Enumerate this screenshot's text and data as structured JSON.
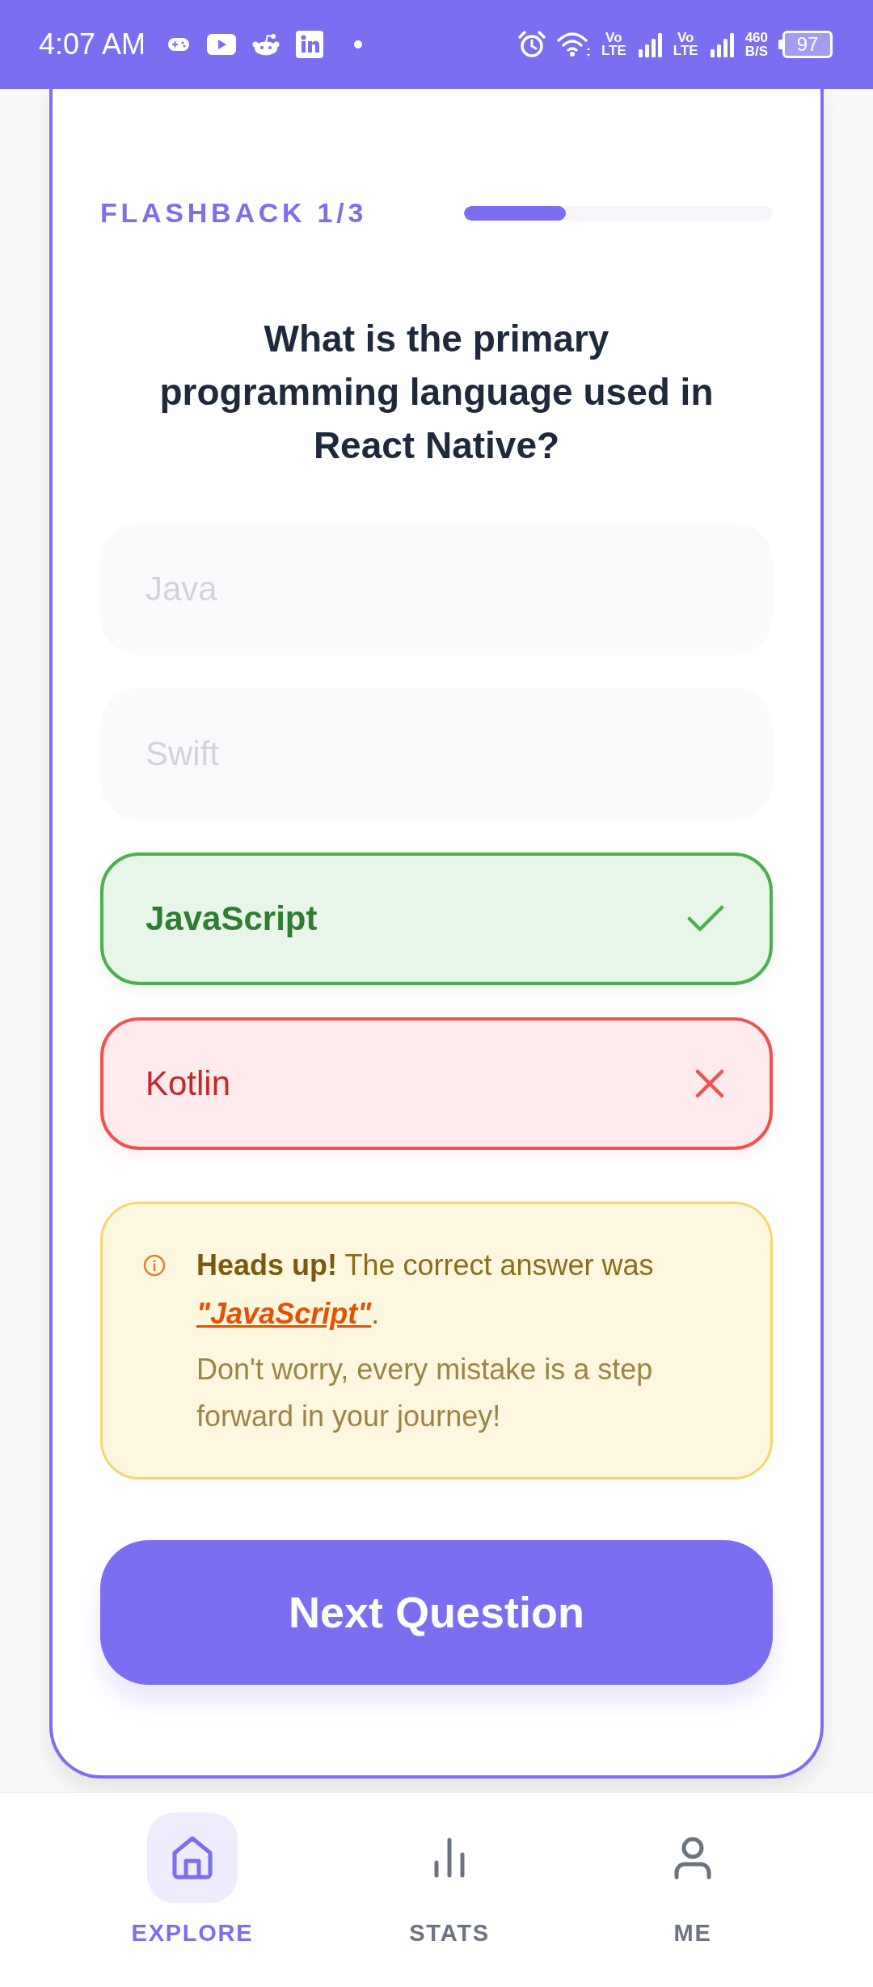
{
  "status_bar": {
    "time": "4:07 AM",
    "network": [
      {
        "line1": "Vo",
        "line2": "LTE"
      },
      {
        "line1": "Vo",
        "line2": "LTE"
      }
    ],
    "data_speed": {
      "value": "460",
      "unit": "B/S"
    },
    "battery": "97"
  },
  "quiz": {
    "label": "FLASHBACK 1/3",
    "progress": {
      "level": 0.33
    },
    "question": "What is the primary programming language used in React Native?",
    "options": [
      {
        "label": "Java",
        "kind": "faded"
      },
      {
        "label": "Swift",
        "kind": "faded"
      },
      {
        "label": "JavaScript",
        "kind": "correct"
      },
      {
        "label": "Kotlin",
        "kind": "wrong"
      }
    ],
    "notice": {
      "lead": "Heads up!",
      "text": "The correct answer was",
      "answer": "\"JavaScript\"",
      "end": ".",
      "encouragement": "Don't worry, every mistake is a step forward in your journey!"
    },
    "next_button": "Next Question"
  },
  "nav": {
    "items": [
      {
        "label": "EXPLORE",
        "selected": true
      },
      {
        "label": "STATS",
        "selected": false
      },
      {
        "label": "ME",
        "selected": false
      }
    ]
  }
}
